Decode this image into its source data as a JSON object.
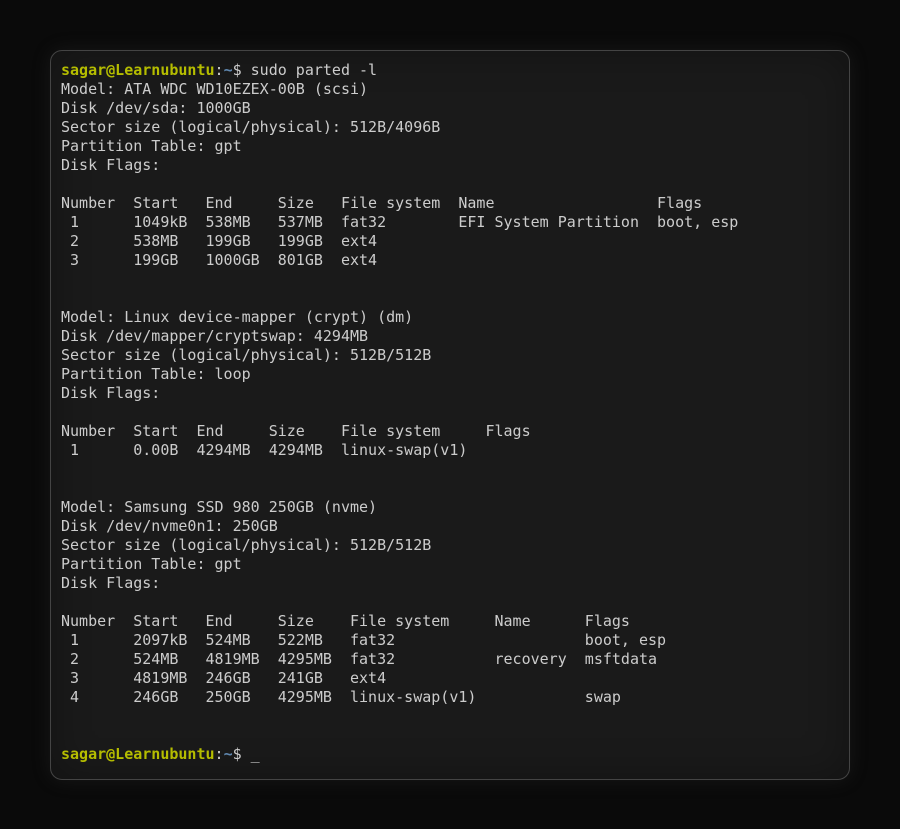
{
  "prompt": {
    "user": "sagar@Learnubuntu",
    "separator": ":",
    "path": "~",
    "symbol": "$"
  },
  "command": " sudo parted -l",
  "output": {
    "disk1": {
      "model": "Model: ATA WDC WD10EZEX-00B (scsi)",
      "disk": "Disk /dev/sda: 1000GB",
      "sector": "Sector size (logical/physical): 512B/4096B",
      "table": "Partition Table: gpt",
      "flags": "Disk Flags: ",
      "header": "Number  Start   End     Size   File system  Name                  Flags",
      "rows": [
        " 1      1049kB  538MB   537MB  fat32        EFI System Partition  boot, esp",
        " 2      538MB   199GB   199GB  ext4",
        " 3      199GB   1000GB  801GB  ext4"
      ]
    },
    "disk2": {
      "model": "Model: Linux device-mapper (crypt) (dm)",
      "disk": "Disk /dev/mapper/cryptswap: 4294MB",
      "sector": "Sector size (logical/physical): 512B/512B",
      "table": "Partition Table: loop",
      "flags": "Disk Flags: ",
      "header": "Number  Start  End     Size    File system     Flags",
      "rows": [
        " 1      0.00B  4294MB  4294MB  linux-swap(v1)"
      ]
    },
    "disk3": {
      "model": "Model: Samsung SSD 980 250GB (nvme)",
      "disk": "Disk /dev/nvme0n1: 250GB",
      "sector": "Sector size (logical/physical): 512B/512B",
      "table": "Partition Table: gpt",
      "flags": "Disk Flags: ",
      "header": "Number  Start   End     Size    File system     Name      Flags",
      "rows": [
        " 1      2097kB  524MB   522MB   fat32                     boot, esp",
        " 2      524MB   4819MB  4295MB  fat32           recovery  msftdata",
        " 3      4819MB  246GB   241GB   ext4",
        " 4      246GB   250GB   4295MB  linux-swap(v1)            swap"
      ]
    }
  },
  "cursor": " _"
}
